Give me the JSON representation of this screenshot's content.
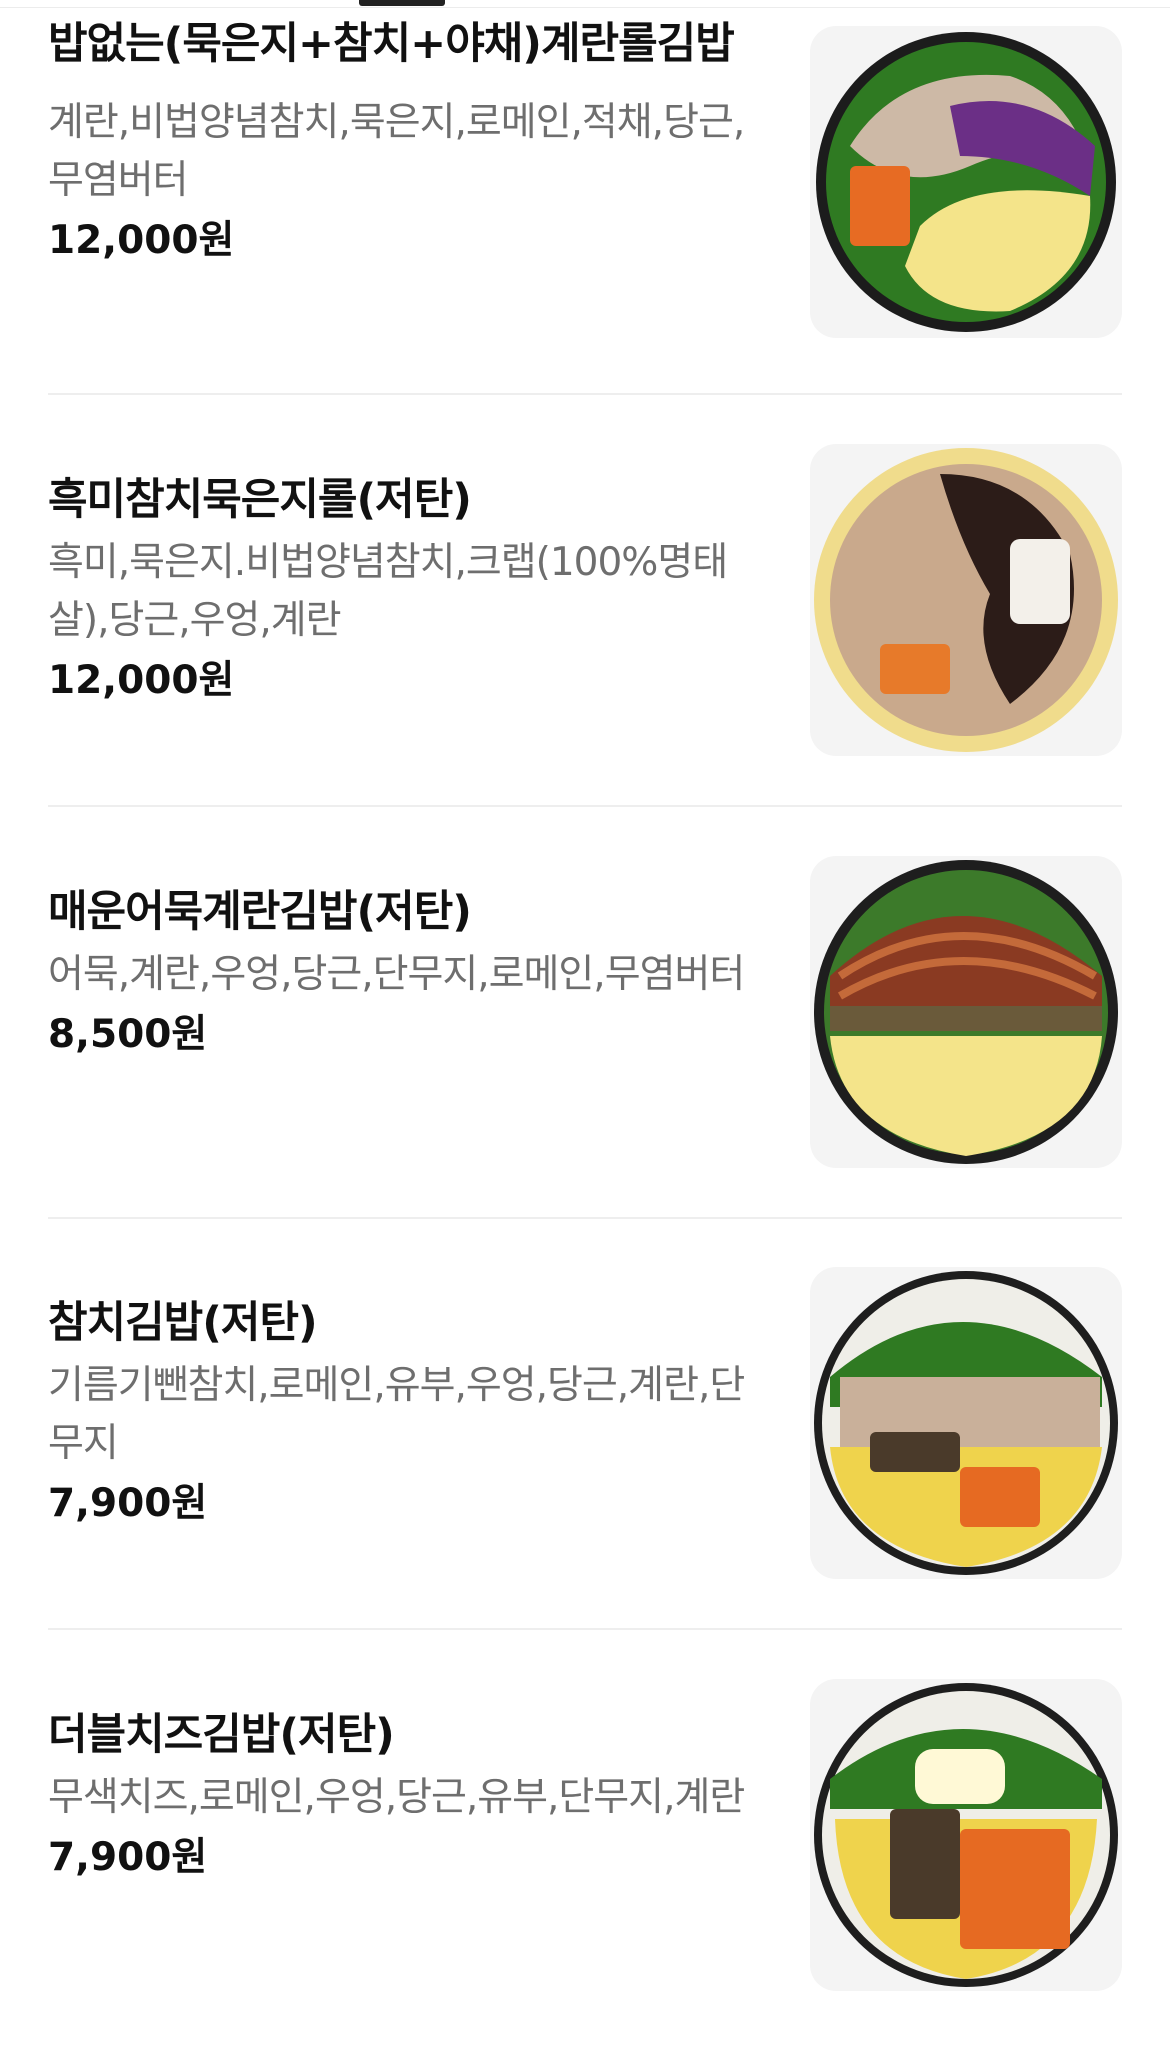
{
  "menu": {
    "items": [
      {
        "name": "밥없는(묵은지+참치+야채)계란롤김밥",
        "ingredients": "계란,비법양념참치,묵은지,로메인,적채,당근,무염버터",
        "price": "12,000원",
        "image_icon": "kimbap-photo-icon"
      },
      {
        "name": "흑미참치묵은지롤(저탄)",
        "ingredients": "흑미,묵은지.비법양념참치,크랩(100%명태살),당근,우엉,계란",
        "price": "12,000원",
        "image_icon": "kimbap-photo-icon"
      },
      {
        "name": "매운어묵계란김밥(저탄)",
        "ingredients": "어묵,계란,우엉,당근,단무지,로메인,무염버터",
        "price": "8,500원",
        "image_icon": "kimbap-photo-icon"
      },
      {
        "name": "참치김밥(저탄)",
        "ingredients": "기름기뺀참치,로메인,유부,우엉,당근,계란,단무지",
        "price": "7,900원",
        "image_icon": "kimbap-photo-icon"
      },
      {
        "name": "더블치즈김밥(저탄)",
        "ingredients": "무색치즈,로메인,우엉,당근,유부,단무지,계란",
        "price": "7,900원",
        "image_icon": "kimbap-photo-icon"
      }
    ]
  },
  "colors": {
    "title": "#111111",
    "description": "#6e6e6e",
    "divider": "#eeeeee",
    "thumb_background": "#f4f4f4"
  }
}
